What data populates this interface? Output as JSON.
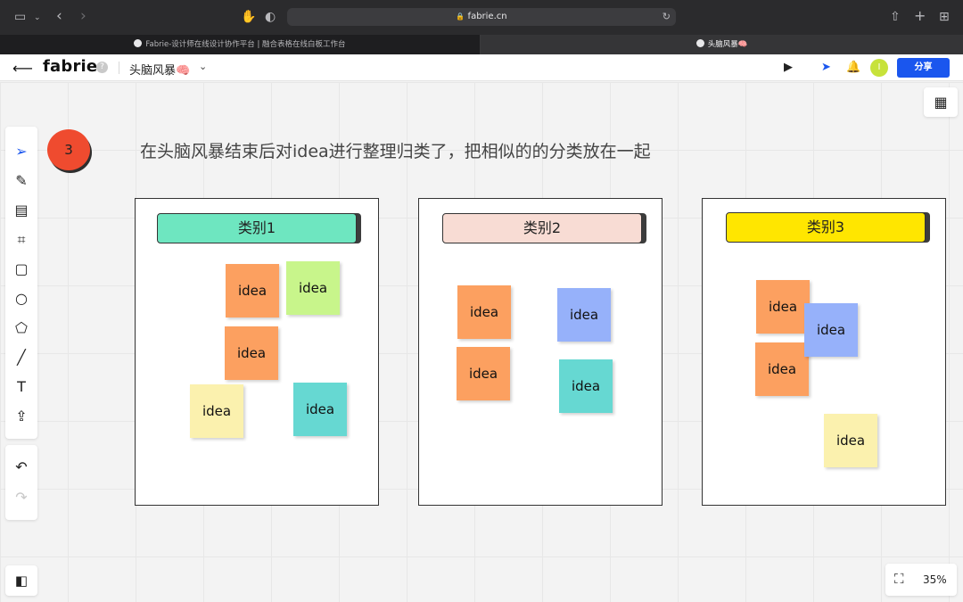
{
  "browser": {
    "url": "fabrie.cn",
    "tabs": [
      {
        "title": "Fabrie-设计师在线设计协作平台 | 融合表格在线白板工作台",
        "active": false
      },
      {
        "title": "头脑风暴🧠",
        "active": true
      }
    ]
  },
  "header": {
    "logo": "fabrie",
    "help": "?",
    "board_title": "头脑风暴🧠",
    "avatar_initial": "I",
    "share_label": "分享"
  },
  "board": {
    "step_number": "3",
    "instruction": "在头脑风暴结束后对idea进行整理归类了，把相似的的分类放在一起",
    "categories": [
      {
        "label": "类别1",
        "color": "#6ee6c0"
      },
      {
        "label": "类别2",
        "color": "#f8dcd4"
      },
      {
        "label": "类别3",
        "color": "#ffe600"
      }
    ],
    "note_text": "idea",
    "notes": [
      {
        "text": "idea",
        "color": "orange",
        "category": 1
      },
      {
        "text": "idea",
        "color": "green",
        "category": 1
      },
      {
        "text": "idea",
        "color": "orange",
        "category": 1
      },
      {
        "text": "idea",
        "color": "yellow",
        "category": 1
      },
      {
        "text": "idea",
        "color": "teal",
        "category": 1
      },
      {
        "text": "idea",
        "color": "orange",
        "category": 2
      },
      {
        "text": "idea",
        "color": "blue",
        "category": 2
      },
      {
        "text": "idea",
        "color": "orange",
        "category": 2
      },
      {
        "text": "idea",
        "color": "teal",
        "category": 2
      },
      {
        "text": "idea",
        "color": "orange",
        "category": 3
      },
      {
        "text": "idea",
        "color": "blue",
        "category": 3
      },
      {
        "text": "idea",
        "color": "orange",
        "category": 3
      },
      {
        "text": "idea",
        "color": "yellow",
        "category": 3
      }
    ]
  },
  "toolbar": {
    "tools": [
      "select-icon",
      "pen-icon",
      "frame-icon",
      "crop-icon",
      "sticky-note-icon",
      "circle-icon",
      "polygon-icon",
      "line-icon",
      "text-icon",
      "upload-icon"
    ],
    "active_tool": "select-icon"
  },
  "zoom": {
    "level": "35%"
  }
}
